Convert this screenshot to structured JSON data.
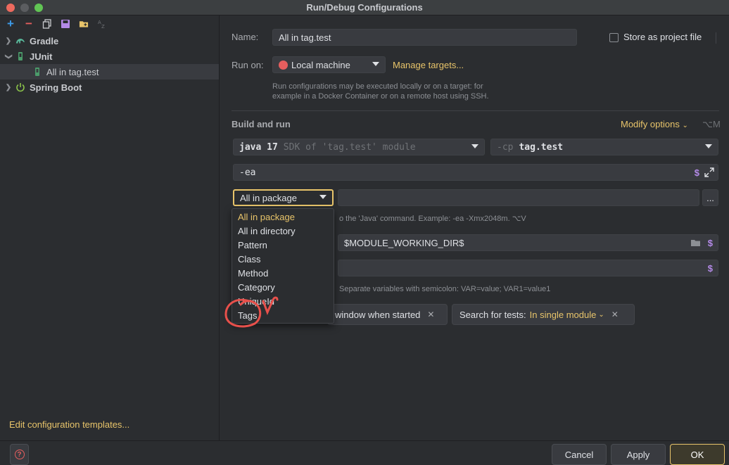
{
  "window": {
    "title": "Run/Debug Configurations"
  },
  "tree": {
    "items": [
      {
        "label": "Gradle"
      },
      {
        "label": "JUnit"
      },
      {
        "label": "All in tag.test"
      },
      {
        "label": "Spring Boot"
      }
    ],
    "edit_templates": "Edit configuration templates..."
  },
  "form": {
    "name_label": "Name:",
    "name_value": "All in tag.test",
    "store_label": "Store as project file",
    "run_on_label": "Run on:",
    "run_on_value": "Local machine",
    "manage_targets": "Manage targets...",
    "run_hint_line1": "Run configurations may be executed locally or on a target: for",
    "run_hint_line2": "example in a Docker Container or on a remote host using SSH.",
    "build_and_run": "Build and run",
    "modify_options": "Modify options",
    "modify_shortcut": "⌥M",
    "jdk_main": "java 17",
    "jdk_sub": "SDK of 'tag.test' module",
    "cp_prefix": "-cp",
    "cp_value": "tag.test",
    "vm_options": "-ea",
    "test_kind": "All in package",
    "vm_hint": "o the 'Java' command. Example: -ea -Xmx2048m. ⌥V",
    "working_dir": "$MODULE_WORKING_DIR$",
    "env_hint": "Separate variables with semicolon: VAR=value; VAR1=value1",
    "chip_window": "window when started",
    "chip_search_label": "Search for tests:",
    "chip_search_value": "In single module",
    "dollar": "$",
    "more": "..."
  },
  "popup": {
    "items": [
      "All in package",
      "All in directory",
      "Pattern",
      "Class",
      "Method",
      "Category",
      "UniqueId",
      "Tags"
    ]
  },
  "buttons": {
    "cancel": "Cancel",
    "apply": "Apply",
    "ok": "OK"
  },
  "colors": {
    "accent": "#e8c46a",
    "background": "#2b2d30",
    "field": "#393b40",
    "annotation": "#e8504b"
  }
}
